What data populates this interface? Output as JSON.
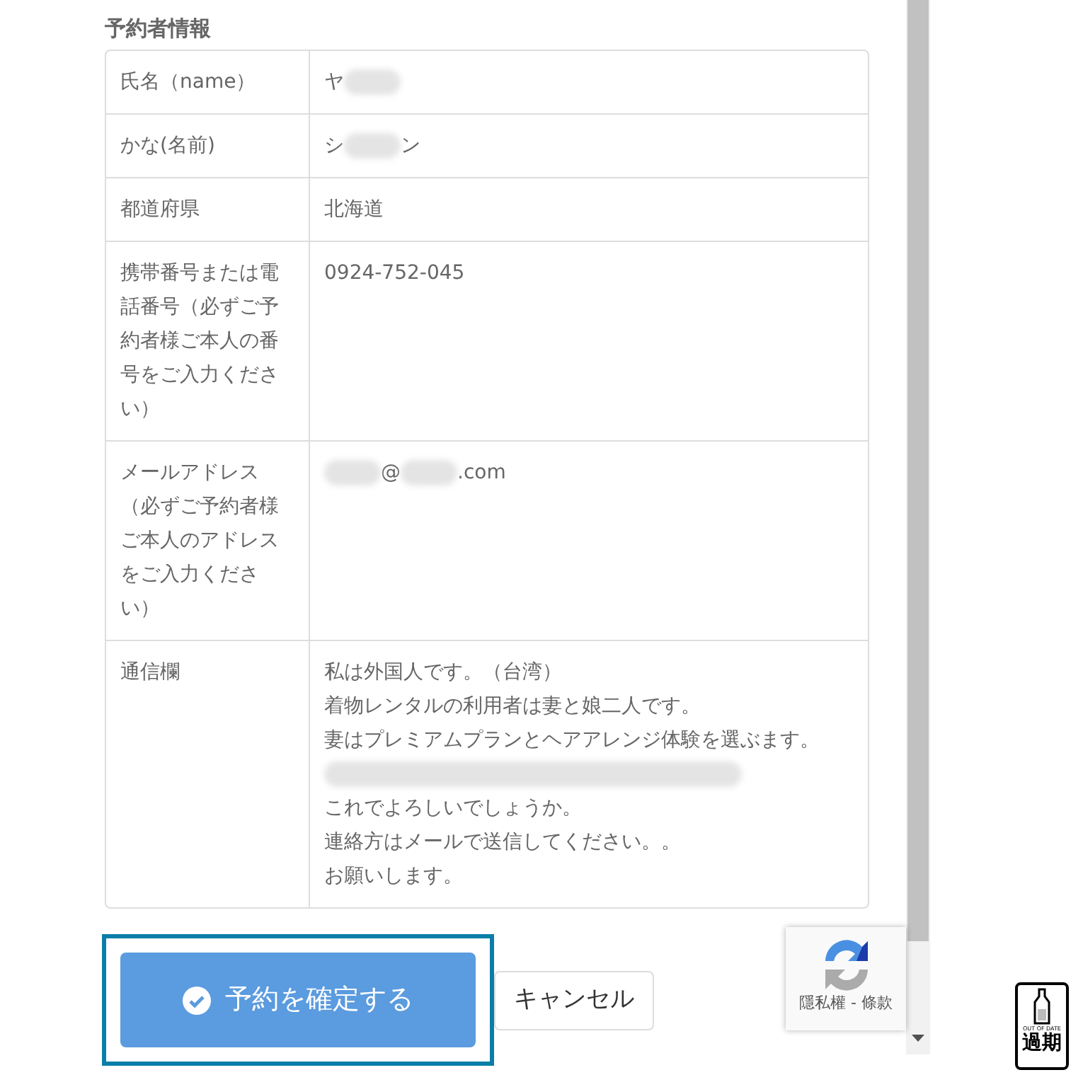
{
  "section_title": "予約者情報",
  "rows": [
    {
      "label": "氏名（name）",
      "value": [
        {
          "kind": "text",
          "text": "ヤ"
        },
        {
          "kind": "blur"
        }
      ]
    },
    {
      "label": "かな(名前)",
      "value": [
        {
          "kind": "text",
          "text": "シ"
        },
        {
          "kind": "blur"
        },
        {
          "kind": "text",
          "text": "ン"
        }
      ]
    },
    {
      "label": "都道府県",
      "value": [
        {
          "kind": "text",
          "text": "北海道"
        }
      ]
    },
    {
      "label": "携帯番号または電話番号（必ずご予約者様ご本人の番号をご入力ください）",
      "value": [
        {
          "kind": "text",
          "text": "0924-752-045"
        }
      ]
    },
    {
      "label": "メールアドレス（必ずご予約者様ご本人のアドレスをご入力ください）",
      "value": [
        {
          "kind": "blur"
        },
        {
          "kind": "text",
          "text": "@"
        },
        {
          "kind": "blur"
        },
        {
          "kind": "text",
          "text": ".com"
        }
      ]
    },
    {
      "label": "通信欄",
      "lines": [
        {
          "kind": "text",
          "text": "私は外国人です。（台湾）"
        },
        {
          "kind": "text",
          "text": "着物レンタルの利用者は妻と娘二人です。"
        },
        {
          "kind": "text",
          "text": "妻はプレミアムプランとヘアアレンジ体験を選ぶます。"
        },
        {
          "kind": "blur"
        },
        {
          "kind": "text",
          "text": "これでよろしいでしょうか。"
        },
        {
          "kind": "text",
          "text": "連絡方はメールで送信してください。。"
        },
        {
          "kind": "text",
          "text": "お願いします。"
        }
      ]
    }
  ],
  "confirm_button": {
    "label": "予約を確定する",
    "focused": true
  },
  "cancel_button": {
    "label": "キャンセル"
  },
  "recaptcha": {
    "links": "隱私權 - 條款"
  },
  "stamp": {
    "caption": "OUT OF DATE",
    "label": "過期"
  }
}
